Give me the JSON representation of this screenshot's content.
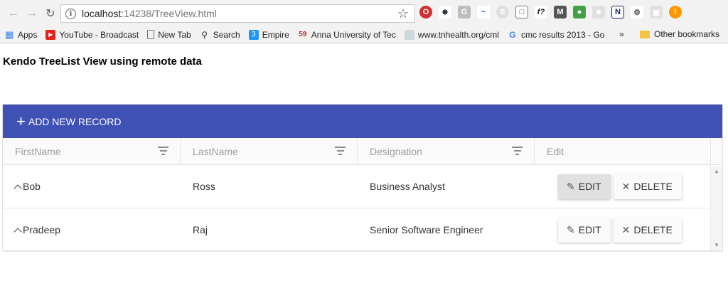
{
  "browser": {
    "url_host": "localhost",
    "url_path": ":14238/TreeView.html",
    "bookmarks": [
      {
        "label": "Apps",
        "icon": "apps-grid-icon",
        "color": "#4285f4"
      },
      {
        "label": "YouTube - Broadcast ",
        "icon": "youtube-icon",
        "color": "#e62117"
      },
      {
        "label": "New Tab",
        "icon": "page-icon",
        "color": "#ffffff"
      },
      {
        "label": "Search",
        "icon": "search-icon",
        "color": "#ffffff"
      },
      {
        "label": "Empire",
        "icon": "empire-icon",
        "color": "#2196f3"
      },
      {
        "label": "Anna University of Tec",
        "icon": "anna-icon",
        "color": "#c62828"
      },
      {
        "label": "www.tnhealth.org/cml",
        "icon": "tnhealth-icon",
        "color": "#90a4ae"
      },
      {
        "label": "cmc results 2013 - Go",
        "icon": "google-icon",
        "color": "#ffffff"
      }
    ],
    "bookmarks_more": "»",
    "other_bookmarks": "Other bookmarks"
  },
  "page": {
    "title": "Kendo TreeList View using remote data"
  },
  "treelist": {
    "toolbar_label": "ADD NEW RECORD",
    "accent_color": "#3f51b5",
    "columns": [
      "FirstName",
      "LastName",
      "Designation",
      "Edit"
    ],
    "rows": [
      {
        "first": "Bob",
        "last": "Ross",
        "designation": "Business Analyst"
      },
      {
        "first": "Pradeep",
        "last": "Raj",
        "designation": "Senior Software Engineer"
      }
    ],
    "edit_label": "EDIT",
    "delete_label": "DELETE"
  }
}
